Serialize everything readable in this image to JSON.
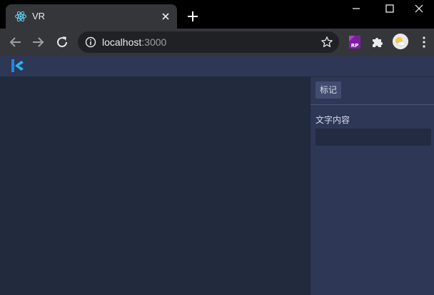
{
  "browser": {
    "tab_title": "VR",
    "url_host": "localhost",
    "url_port": ":3000",
    "extension_rp_label": "RP"
  },
  "side_panel": {
    "mark_tab_label": "标记",
    "text_content_label": "文字内容",
    "text_content_value": ""
  },
  "colors": {
    "app_header": "#2e3756",
    "canvas": "#222a3d",
    "panel": "#2e3756",
    "accent_logo": "#29b6f6"
  },
  "icons": [
    "react-favicon-icon",
    "close-icon",
    "plus-icon",
    "minimize-icon",
    "maximize-icon",
    "window-close-icon",
    "back-arrow-icon",
    "forward-arrow-icon",
    "reload-icon",
    "info-icon",
    "star-icon",
    "rp-extension-icon",
    "puzzle-icon",
    "avatar",
    "kebab-menu-icon",
    "app-logo-icon"
  ]
}
